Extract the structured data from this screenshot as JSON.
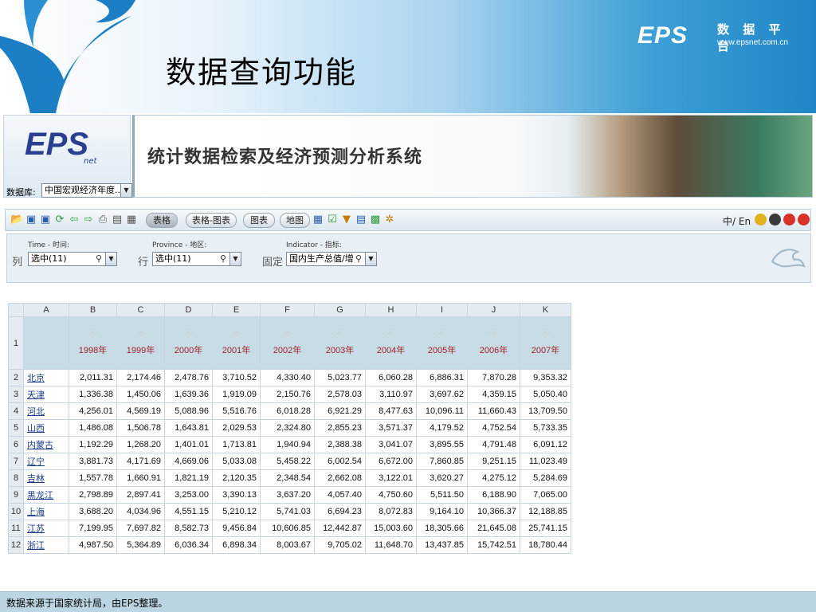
{
  "slide": {
    "title": "数据查询功能",
    "brand_logo": "EPS",
    "brand_cn": "数 据 平 台",
    "brand_url": "www.epsnet.com.cn"
  },
  "banner": {
    "logo": "EPS",
    "logo_sub": "net",
    "title": "统计数据检索及经济预测分析系统",
    "db_label": "数据库:",
    "db_value": "中国宏观经济年度..."
  },
  "toolbar": {
    "tabs": [
      "表格",
      "表格-图表",
      "图表",
      "地图"
    ],
    "lang": "中/ En"
  },
  "filters": {
    "col_side": "列",
    "col_label": "Time - 时间:",
    "col_value": "选中(11)",
    "row_side": "行",
    "row_label": "Province - 地区:",
    "row_value": "选中(11)",
    "fixed_side": "固定",
    "fixed_label": "Indicator - 指标:",
    "fixed_value": "国内生产总值/增..."
  },
  "table": {
    "col_letters": [
      "A",
      "B",
      "C",
      "D",
      "E",
      "F",
      "G",
      "H",
      "I",
      "J",
      "K"
    ],
    "years": [
      "1998年",
      "1999年",
      "2000年",
      "2001年",
      "2002年",
      "2003年",
      "2004年",
      "2005年",
      "2006年",
      "2007年"
    ],
    "rows": [
      {
        "num": "2",
        "province": "北京",
        "values": [
          "2,011.31",
          "2,174.46",
          "2,478.76",
          "3,710.52",
          "4,330.40",
          "5,023.77",
          "6,060.28",
          "6,886.31",
          "7,870.28",
          "9,353.32"
        ]
      },
      {
        "num": "3",
        "province": "天津",
        "values": [
          "1,336.38",
          "1,450.06",
          "1,639.36",
          "1,919.09",
          "2,150.76",
          "2,578.03",
          "3,110.97",
          "3,697.62",
          "4,359.15",
          "5,050.40"
        ]
      },
      {
        "num": "4",
        "province": "河北",
        "values": [
          "4,256.01",
          "4,569.19",
          "5,088.96",
          "5,516.76",
          "6,018.28",
          "6,921.29",
          "8,477.63",
          "10,096.11",
          "11,660.43",
          "13,709.50"
        ]
      },
      {
        "num": "5",
        "province": "山西",
        "values": [
          "1,486.08",
          "1,506.78",
          "1,643.81",
          "2,029.53",
          "2,324.80",
          "2,855.23",
          "3,571.37",
          "4,179.52",
          "4,752.54",
          "5,733.35"
        ]
      },
      {
        "num": "6",
        "province": "内蒙古",
        "values": [
          "1,192.29",
          "1,268.20",
          "1,401.01",
          "1,713.81",
          "1,940.94",
          "2,388.38",
          "3,041.07",
          "3,895.55",
          "4,791.48",
          "6,091.12"
        ]
      },
      {
        "num": "7",
        "province": "辽宁",
        "values": [
          "3,881.73",
          "4,171.69",
          "4,669.06",
          "5,033.08",
          "5,458.22",
          "6,002.54",
          "6,672.00",
          "7,860.85",
          "9,251.15",
          "11,023.49"
        ]
      },
      {
        "num": "8",
        "province": "吉林",
        "values": [
          "1,557.78",
          "1,660.91",
          "1,821.19",
          "2,120.35",
          "2,348.54",
          "2,662.08",
          "3,122.01",
          "3,620.27",
          "4,275.12",
          "5,284.69"
        ]
      },
      {
        "num": "9",
        "province": "黑龙江",
        "values": [
          "2,798.89",
          "2,897.41",
          "3,253.00",
          "3,390.13",
          "3,637.20",
          "4,057.40",
          "4,750.60",
          "5,511.50",
          "6,188.90",
          "7,065.00"
        ]
      },
      {
        "num": "10",
        "province": "上海",
        "values": [
          "3,688.20",
          "4,034.96",
          "4,551.15",
          "5,210.12",
          "5,741.03",
          "6,694.23",
          "8,072.83",
          "9,164.10",
          "10,366.37",
          "12,188.85"
        ]
      },
      {
        "num": "11",
        "province": "江苏",
        "values": [
          "7,199.95",
          "7,697.82",
          "8,582.73",
          "9,456.84",
          "10,606.85",
          "12,442.87",
          "15,003.60",
          "18,305.66",
          "21,645.08",
          "25,741.15"
        ]
      },
      {
        "num": "12",
        "province": "浙江",
        "values": [
          "4,987.50",
          "5,364.89",
          "6,036.34",
          "6,898.34",
          "8,003.67",
          "9,705.02",
          "11,648.70",
          "13,437.85",
          "15,742.51",
          "18,780.44"
        ]
      }
    ]
  },
  "footer": {
    "note": "数据来源于国家统计局，由EPS整理。"
  }
}
